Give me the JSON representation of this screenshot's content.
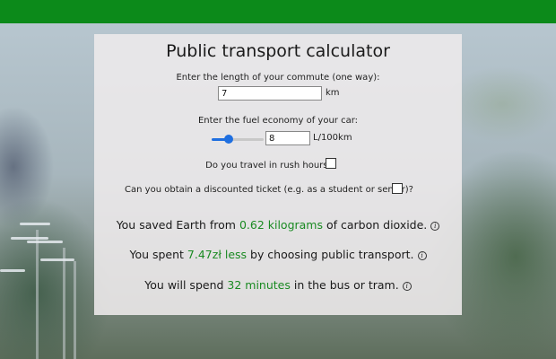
{
  "header": {
    "color": "#0c8a1a"
  },
  "title": "Public transport calculator",
  "commute": {
    "label": "Enter the length of your commute (one way):",
    "value": "7",
    "unit": "km"
  },
  "fuel": {
    "label": "Enter the fuel economy of your car:",
    "value": "8",
    "unit": "L/100km",
    "slider_fraction": 0.31
  },
  "rush_hours": {
    "label": "Do you travel in rush hours?",
    "checked": false
  },
  "discount": {
    "label": "Can you obtain a discounted ticket (e.g. as a student or senior)?",
    "checked": false
  },
  "results": {
    "co2": {
      "prefix": "You saved Earth from ",
      "value": "0.62 kilograms",
      "suffix": " of carbon dioxide."
    },
    "money": {
      "prefix": "You spent ",
      "value": "7.47zł less",
      "suffix": " by choosing public transport."
    },
    "time": {
      "prefix": "You will spend ",
      "value": "32 minutes",
      "suffix": " in the bus or tram."
    }
  },
  "icons": {
    "info": "info-icon"
  },
  "colors": {
    "accent": "#1a8a22",
    "slider": "#1f6fe0"
  }
}
